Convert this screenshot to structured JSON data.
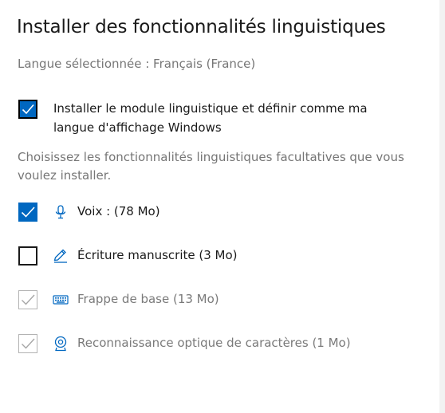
{
  "title": "Installer des fonctionnalités linguistiques",
  "selected_language": "Langue sélectionnée : Français (France)",
  "main_option": {
    "label": "Installer le module linguistique et définir comme ma langue d'affichage Windows",
    "checked": true
  },
  "optional_prompt": "Choisissez les fonctionnalités linguistiques facultatives que vous voulez installer.",
  "features": [
    {
      "label": "Voix : (78 Mo)",
      "icon": "microphone-icon",
      "checked": true,
      "enabled": true
    },
    {
      "label": "Écriture manuscrite (3 Mo)",
      "icon": "pen-icon",
      "checked": false,
      "enabled": true
    },
    {
      "label": "Frappe de base (13 Mo)",
      "icon": "keyboard-icon",
      "checked": true,
      "enabled": false
    },
    {
      "label": "Reconnaissance optique de caractères (1 Mo)",
      "icon": "camera-icon",
      "checked": true,
      "enabled": false
    }
  ],
  "colors": {
    "accent": "#0067c0",
    "text": "#1a1a1a",
    "secondary_text": "#767676",
    "disabled": "#b3b3b3"
  }
}
